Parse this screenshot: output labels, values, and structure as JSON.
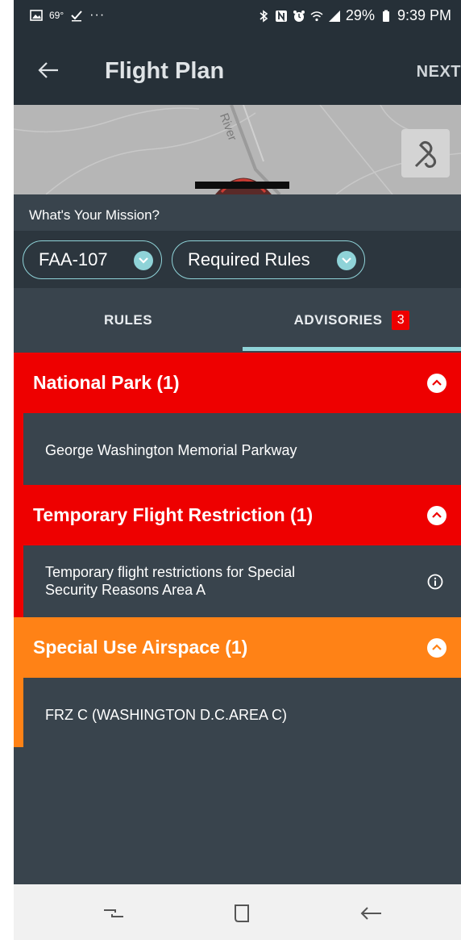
{
  "status_bar": {
    "temperature": "69°",
    "more": "···",
    "battery": "29%",
    "time": "9:39 PM"
  },
  "header": {
    "title": "Flight Plan",
    "next_label": "NEXT"
  },
  "map": {
    "river_label": "River"
  },
  "mission": {
    "label": "What's Your Mission?",
    "chips": [
      {
        "label": "FAA-107"
      },
      {
        "label": "Required Rules"
      }
    ]
  },
  "tabs": {
    "rules_label": "RULES",
    "advisories_label": "ADVISORIES",
    "advisories_count": "3",
    "active": "advisories"
  },
  "advisory_groups": [
    {
      "title": "National Park (1)",
      "color": "#ee0000",
      "items": [
        {
          "text": "George Washington Memorial Parkway"
        }
      ]
    },
    {
      "title": "Temporary Flight Restriction (1)",
      "color": "#ee0000",
      "items": [
        {
          "text_line1": "Temporary flight restrictions for Special",
          "text_line2": "Security Reasons Area A",
          "icon": "info-icon"
        }
      ]
    },
    {
      "title": "Special Use Airspace (1)",
      "color": "#ff8216",
      "items": [
        {
          "text": "FRZ C (WASHINGTON D.C.AREA C)"
        }
      ]
    }
  ],
  "colors": {
    "accent": "#8fd3d8",
    "background": "#39444d",
    "header": "#263038"
  }
}
